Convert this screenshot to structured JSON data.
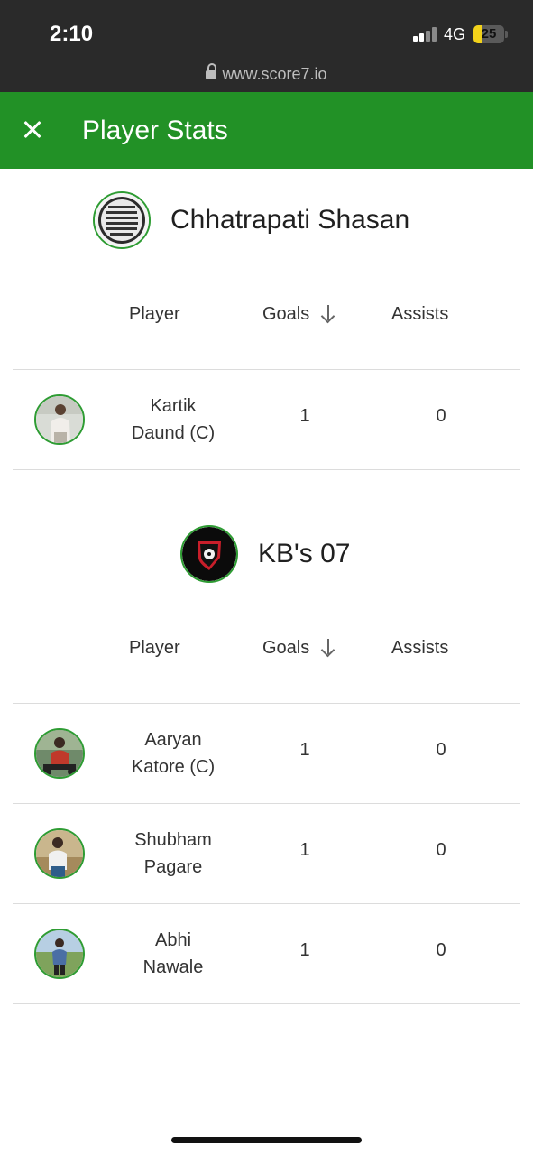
{
  "status_bar": {
    "time": "2:10",
    "network": "4G",
    "battery": "25",
    "battery_level": 0.25
  },
  "browser": {
    "url": "www.score7.io"
  },
  "header": {
    "title": "Player Stats"
  },
  "columns": {
    "player": "Player",
    "goals": "Goals",
    "assists": "Assists"
  },
  "teams": [
    {
      "name": "Chhatrapati Shasan",
      "players": [
        {
          "name_line1": "Kartik",
          "name_line2": "Daund (C)",
          "goals": "1",
          "assists": "0"
        }
      ]
    },
    {
      "name": "KB's 07",
      "players": [
        {
          "name_line1": "Aaryan",
          "name_line2": "Katore (C)",
          "goals": "1",
          "assists": "0"
        },
        {
          "name_line1": "Shubham",
          "name_line2": "Pagare",
          "goals": "1",
          "assists": "0"
        },
        {
          "name_line1": "Abhi",
          "name_line2": "Nawale",
          "goals": "1",
          "assists": "0"
        }
      ]
    }
  ],
  "colors": {
    "header_green": "#229126",
    "avatar_ring": "#2e9c33",
    "status_bar": "#2a2a2a",
    "battery_yellow": "#f2d21a"
  }
}
